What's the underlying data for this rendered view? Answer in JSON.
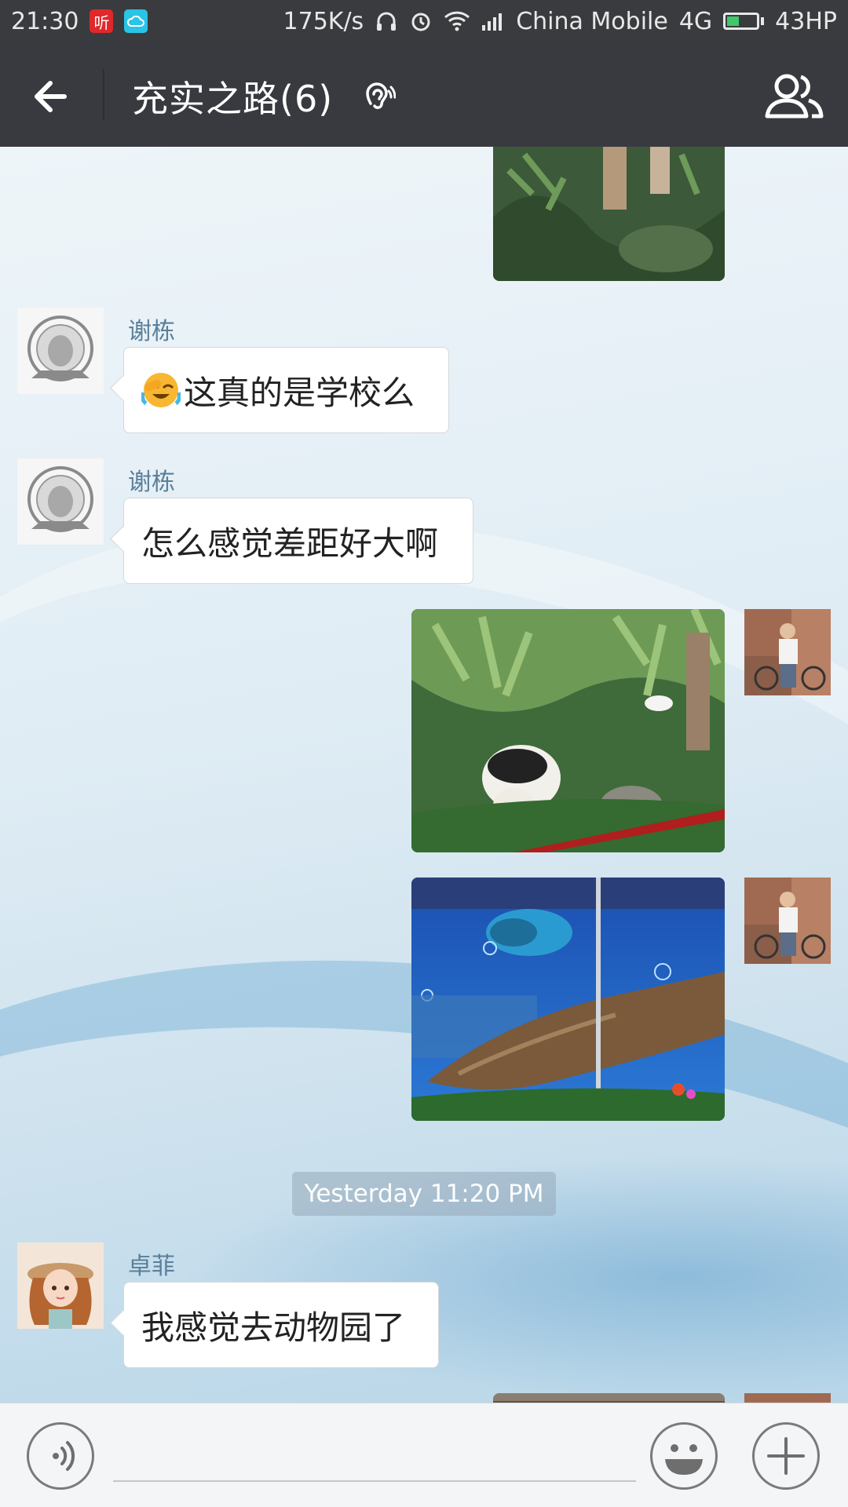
{
  "status_bar": {
    "time": "21:30",
    "app_badge_1": "听",
    "speed": "175K/s",
    "carrier": "China Mobile",
    "network": "4G",
    "battery_text": "43HP",
    "battery_level": 0.43
  },
  "header": {
    "title": "充实之路(6)"
  },
  "messages": [
    {
      "type": "image",
      "side": "right",
      "sender": "me",
      "content": "partial-photo-plants"
    },
    {
      "type": "text",
      "side": "left",
      "sender": "谢栋",
      "text": "这真的是学校么",
      "emoji": "facepalm-laugh"
    },
    {
      "type": "text",
      "side": "left",
      "sender": "谢栋",
      "text": "怎么感觉差距好大啊"
    },
    {
      "type": "image",
      "side": "right",
      "sender": "me",
      "content": "photo-panda-exhibit"
    },
    {
      "type": "image",
      "side": "right",
      "sender": "me",
      "content": "photo-fish-aquarium"
    },
    {
      "type": "timestamp",
      "text": "Yesterday 11:20 PM"
    },
    {
      "type": "text",
      "side": "left",
      "sender": "卓菲",
      "text": "我感觉去动物园了"
    }
  ],
  "input": {
    "placeholder": ""
  },
  "colors": {
    "status_bar": "#3a3b3f",
    "title_bar": "#393a3f",
    "battery": "#3ec86a",
    "name_text": "#5a7f9a"
  }
}
